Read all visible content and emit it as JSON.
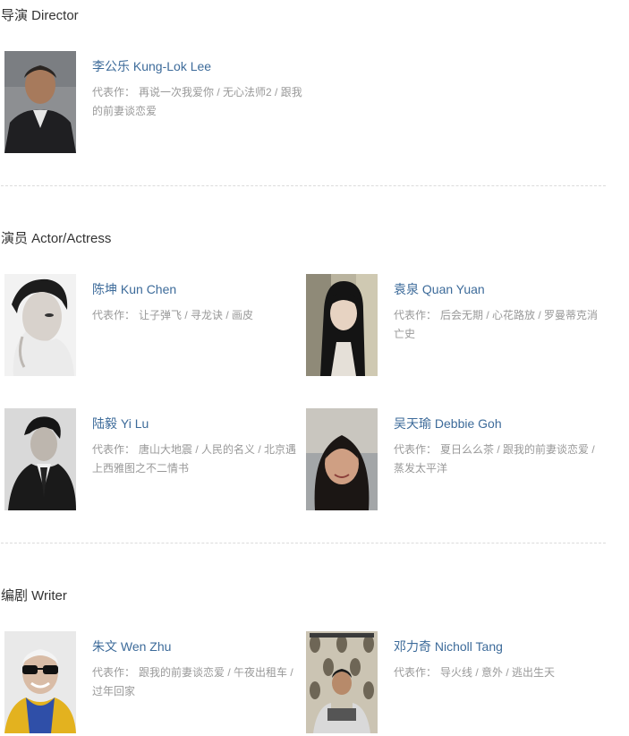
{
  "sections": {
    "director": {
      "title": "导演 Director"
    },
    "actors": {
      "title": "演员 Actor/Actress"
    },
    "writers": {
      "title": "编剧 Writer"
    }
  },
  "works_label": "代表作：",
  "people": {
    "lee": {
      "name": "李公乐 Kung-Lok Lee",
      "works": "再说一次我爱你 / 无心法师2 / 跟我的前妻谈恋爱"
    },
    "chen": {
      "name": "陈坤 Kun Chen",
      "works": "让子弹飞 / 寻龙诀 / 画皮"
    },
    "yuan": {
      "name": "袁泉 Quan Yuan",
      "works": "后会无期 / 心花路放 / 罗曼蒂克消亡史"
    },
    "lu": {
      "name": "陆毅 Yi Lu",
      "works": "唐山大地震 / 人民的名义 / 北京遇上西雅图之不二情书"
    },
    "goh": {
      "name": "吴天瑜 Debbie Goh",
      "works": "夏日么么茶 / 跟我的前妻谈恋爱 / 蒸发太平洋"
    },
    "zhu": {
      "name": "朱文 Wen Zhu",
      "works": "跟我的前妻谈恋爱 / 午夜出租车 / 过年回家"
    },
    "tang": {
      "name": "邓力奇 Nicholl Tang",
      "works": "导火线 / 意外 / 逃出生天"
    }
  }
}
